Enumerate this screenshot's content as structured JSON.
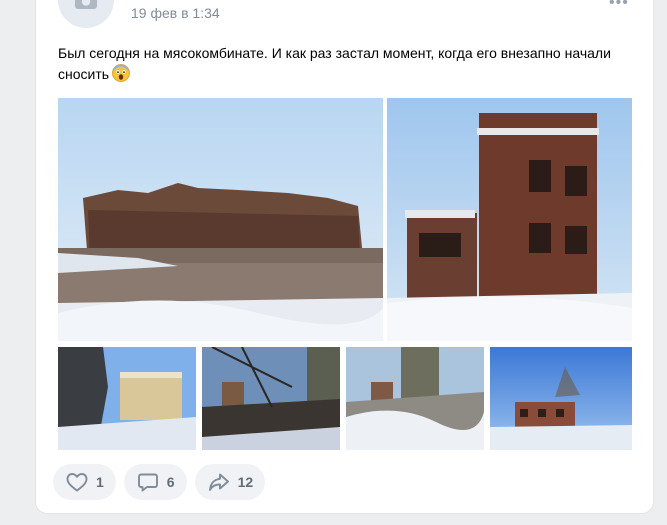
{
  "post": {
    "date": "19 фев в 1:34",
    "more_label": "•••",
    "text": "Был сегодня на мясокомбинате. И как раз застал момент, когда его внезапно начали сносить",
    "emoji": "face-screaming-emoji",
    "photos": [
      {
        "name": "photo-1",
        "subject": "ruined-building-wide"
      },
      {
        "name": "photo-2",
        "subject": "brick-tower"
      },
      {
        "name": "photo-3",
        "subject": "ruin-through-trees"
      },
      {
        "name": "photo-4",
        "subject": "ruin-with-branches"
      },
      {
        "name": "photo-5",
        "subject": "concrete-tower-rubble"
      },
      {
        "name": "photo-6",
        "subject": "brick-building-distant"
      }
    ]
  },
  "actions": {
    "likes": "1",
    "comments": "6",
    "shares": "12"
  },
  "colors": {
    "background": "#edeef0",
    "card": "#ffffff",
    "secondary_text": "#818c99",
    "button_bg": "#f0f2f5",
    "button_text": "#626d7a"
  }
}
